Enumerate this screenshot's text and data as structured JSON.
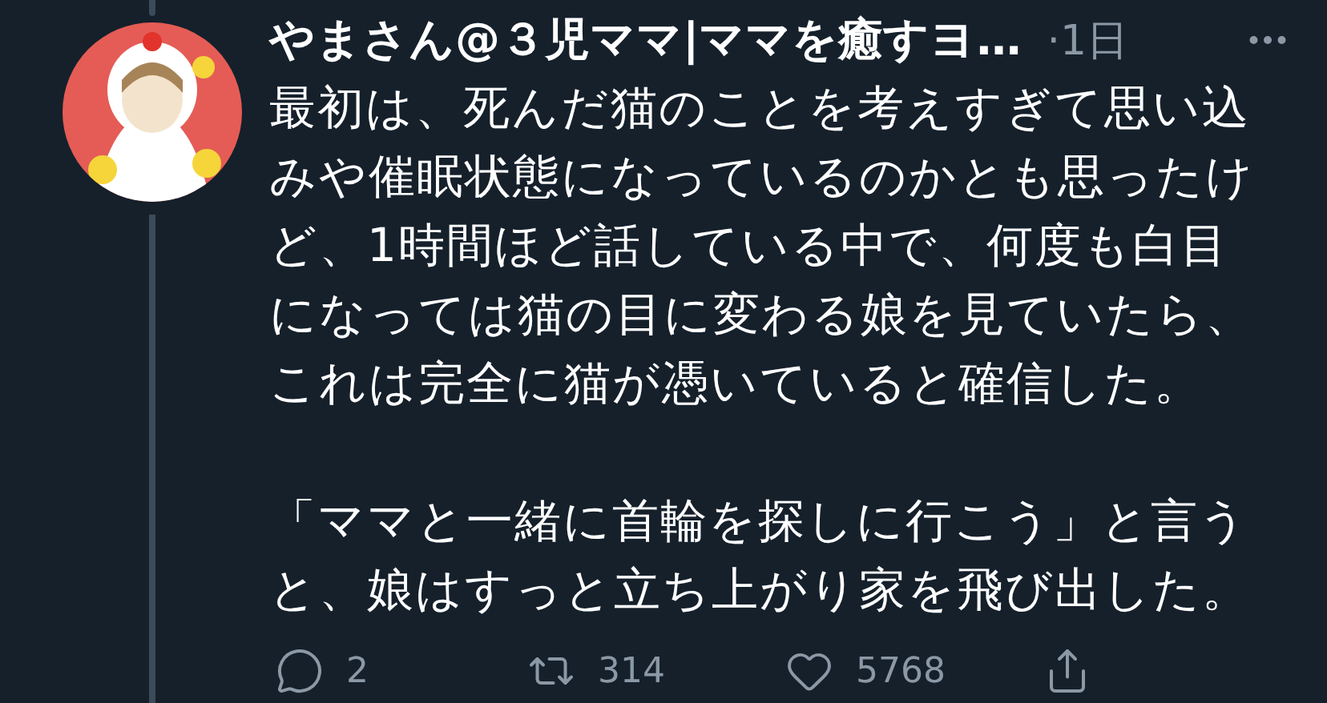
{
  "tweet": {
    "author": {
      "name": "やまさん@３児ママ|ママを癒すヨ…"
    },
    "time": "·1日",
    "paragraphs": [
      "最初は、死んだ猫のことを考えすぎて思い込みや催眠状態になっているのかとも思ったけど、1時間ほど話している中で、何度も白目になっては猫の目に変わる娘を見ていたら、これは完全に猫が憑いていると確信した。",
      "「ママと一緒に首輪を探しに行こう」と言うと、娘はすっと立ち上がり家を飛び出した。"
    ],
    "actions": [
      {
        "kind": "reply",
        "count": "2"
      },
      {
        "kind": "retweet",
        "count": "314"
      },
      {
        "kind": "like",
        "count": "5768"
      },
      {
        "kind": "share"
      }
    ]
  }
}
